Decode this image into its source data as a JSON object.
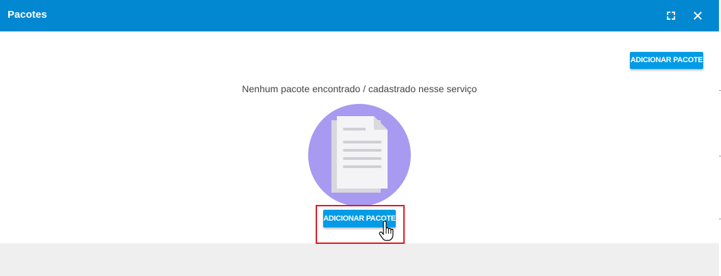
{
  "dialog": {
    "title": "Pacotes",
    "maximize_icon": "fullscreen-icon",
    "close_icon": "close-icon"
  },
  "toolbar": {
    "add_package_label": "ADICIONAR PACOTE"
  },
  "empty_state": {
    "message": "Nenhum pacote encontrado / cadastrado nesse serviço",
    "illustration_icon": "document-icon",
    "add_package_label": "ADICIONAR PACOTE"
  },
  "colors": {
    "titlebar": "#0288d1",
    "button": "#039be5",
    "illustration_circle": "#a79af0",
    "highlight": "#e0161f"
  }
}
